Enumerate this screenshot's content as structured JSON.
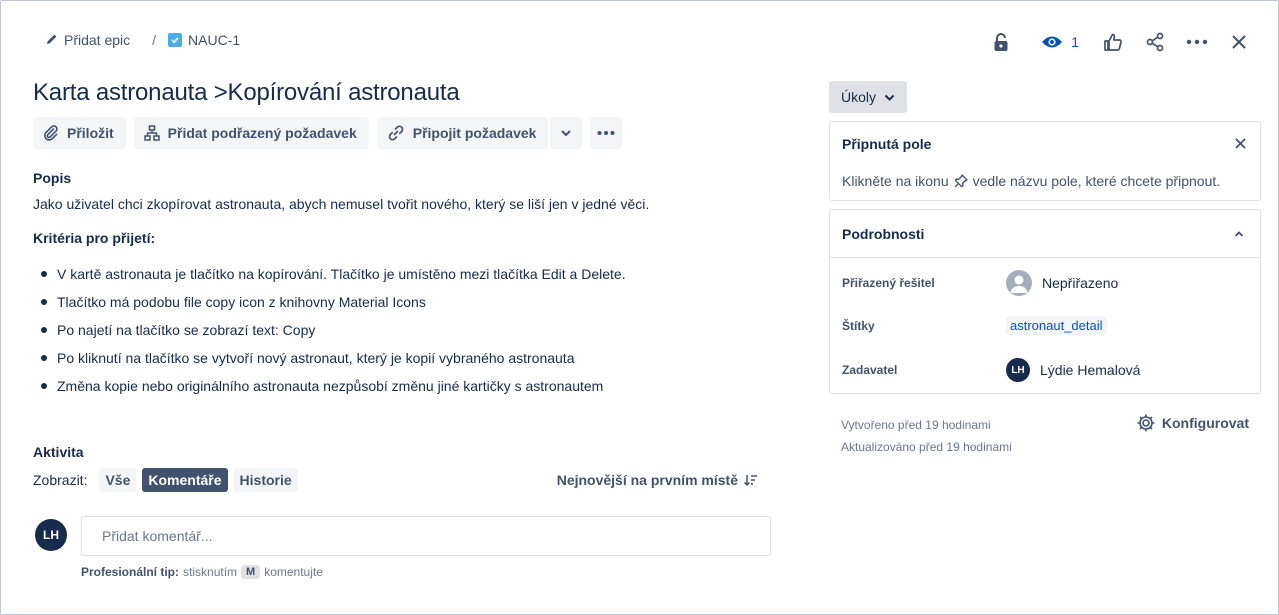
{
  "breadcrumb": {
    "epic_label": "Přidat epic",
    "separator": "/",
    "issue_key": "NAUC-1"
  },
  "toolbar": {
    "watch_count": "1"
  },
  "issue": {
    "title": "Karta astronauta >Kopírování astronauta"
  },
  "actions": {
    "attach": "Přiložit",
    "add_child": "Přidat podřazený požadavek",
    "link": "Připojit požadavek"
  },
  "description": {
    "heading": "Popis",
    "text": "Jako uživatel chci zkopírovat astronauta, abych nemusel tvořit nového, který se liší jen v jedné věci.",
    "criteria_heading": "Kritéria pro přijetí:",
    "criteria": [
      "V kartě astronauta je tlačítko na kopírování. Tlačítko je umístěno mezi tlačítka Edit a Delete.",
      "Tlačítko má podobu file copy icon z knihovny Material Icons",
      "Po najetí na tlačítko se zobrazí text: Copy",
      "Po kliknutí na tlačítko se vytvoří nový astronaut, který je kopií vybraného astronauta",
      "Změna kopie nebo originálního astronauta nezpůsobí změnu jiné kartičky s astronautem"
    ]
  },
  "activity": {
    "heading": "Aktivita",
    "show_label": "Zobrazit:",
    "filters": [
      "Vše",
      "Komentáře",
      "Historie"
    ],
    "active_filter": "Komentáře",
    "sort_label": "Nejnovější na prvním místě",
    "comment_avatar": "LH",
    "comment_placeholder": "Přidat komentář...",
    "tip_bold": "Profesionální tip:",
    "tip_pre": "stisknutím",
    "tip_key": "M",
    "tip_post": "komentujte"
  },
  "sidebar": {
    "status_button": "Úkoly",
    "pinned": {
      "heading": "Připnutá pole",
      "text_before": "Klikněte na ikonu",
      "text_after": "vedle názvu pole, které chcete připnout."
    },
    "details": {
      "heading": "Podrobnosti",
      "assignee_label": "Přiřazený řešitel",
      "assignee_value": "Nepřiřazeno",
      "labels_label": "Štítky",
      "labels_value": "astronaut_detail",
      "reporter_label": "Zadavatel",
      "reporter_initials": "LH",
      "reporter_name": "Lýdie Hemalová"
    },
    "created": "Vytvořeno před 19 hodinami",
    "updated": "Aktualizováno před 19 hodinami",
    "configure": "Konfigurovat"
  },
  "colors": {
    "accent": "#0052cc",
    "text": "#172b4d",
    "subtle": "#42526e",
    "chip_active": "#42526e",
    "checkbox": "#4bade8"
  }
}
